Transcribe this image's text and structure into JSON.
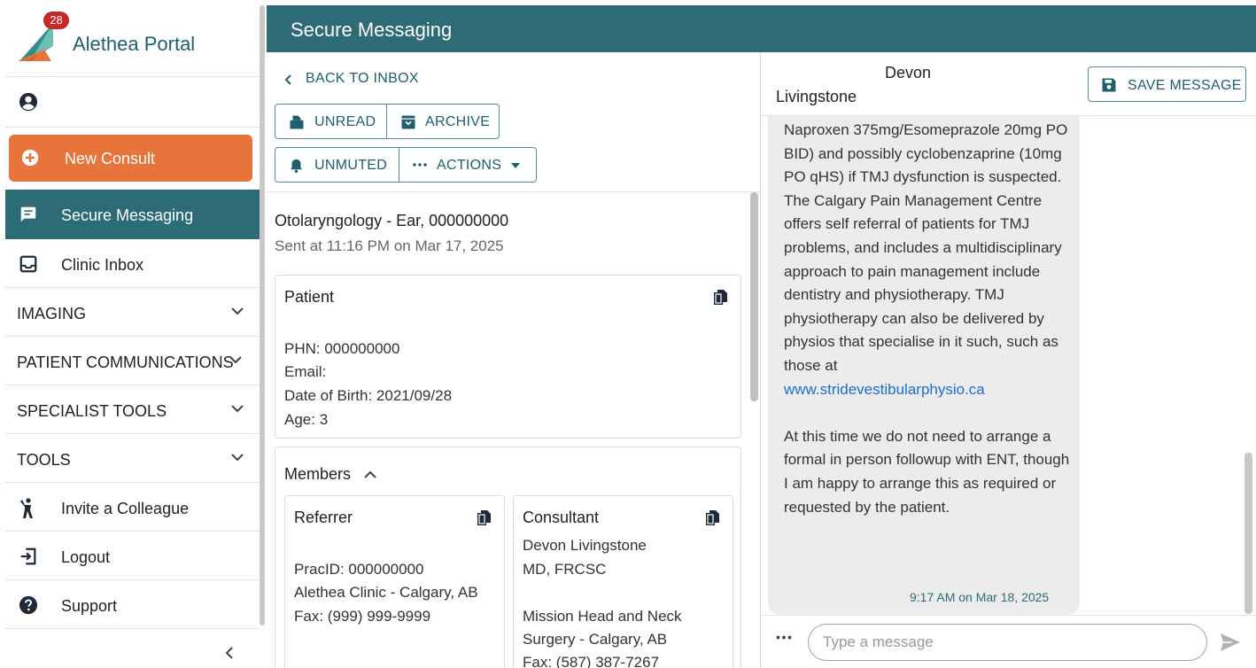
{
  "sidebar": {
    "brand": "Alethea Portal",
    "notification_count": "28",
    "new_consult_label": "New Consult",
    "nav": {
      "secure_messaging": "Secure Messaging",
      "clinic_inbox": "Clinic Inbox",
      "imaging": "IMAGING",
      "patient_communications": "PATIENT COMMUNICATIONS",
      "specialist_tools": "SPECIALIST TOOLS",
      "tools": "TOOLS",
      "invite": "Invite a Colleague",
      "logout": "Logout",
      "support": "Support"
    }
  },
  "header": {
    "title": "Secure Messaging"
  },
  "thread": {
    "back_label": "BACK TO INBOX",
    "actions": {
      "unread": "UNREAD",
      "archive": "ARCHIVE",
      "unmuted": "UNMUTED",
      "actions": "ACTIONS"
    },
    "subject": "Otolaryngology - Ear, 000000000",
    "sent": "Sent at 11:16 PM on Mar 17, 2025",
    "patient": {
      "heading": "Patient",
      "phn": "PHN: 000000000",
      "email": "Email:",
      "dob": "Date of Birth: 2021/09/28",
      "age": "Age: 3"
    },
    "members": {
      "heading": "Members",
      "referrer": {
        "heading": "Referrer",
        "prac_id": "PracID: 000000000",
        "clinic": "Alethea Clinic - Calgary, AB",
        "fax": "Fax: (999) 999-9999"
      },
      "consultant": {
        "heading": "Consultant",
        "name": "Devon Livingstone",
        "credentials": "MD, FRCSC",
        "org_line1": "Mission Head and Neck",
        "org_line2": "Surgery - Calgary, AB",
        "fax": "Fax: (587) 387-7267"
      }
    }
  },
  "conversation": {
    "contact_first": "Devon",
    "contact_last": "Livingstone",
    "save_label": "SAVE MESSAGE",
    "message_part1": "Naproxen 375mg/Esomeprazole 20mg PO BID) and possibly cyclobenzaprine (10mg PO qHS) if TMJ dysfunction is suspected. The Calgary Pain Management Centre offers self referral of patients for TMJ problems, and includes a multidisciplinary approach to pain management include dentistry and physiotherapy. TMJ physiotherapy can also be delivered by physios that specialise in it such, such as those at",
    "message_link": "www.stridevestibularphysio.ca",
    "message_part2": "At this time we do not need to arrange a formal in person followup with ENT, though I am happy to arrange this as required or requested by the patient.",
    "timestamp": "9:17 AM on Mar 18, 2025",
    "compose_placeholder": "Type a message"
  },
  "colors": {
    "primary": "#2d6b76",
    "accent": "#e8743b",
    "badge": "#c62828",
    "link": "#1a6fd0"
  }
}
